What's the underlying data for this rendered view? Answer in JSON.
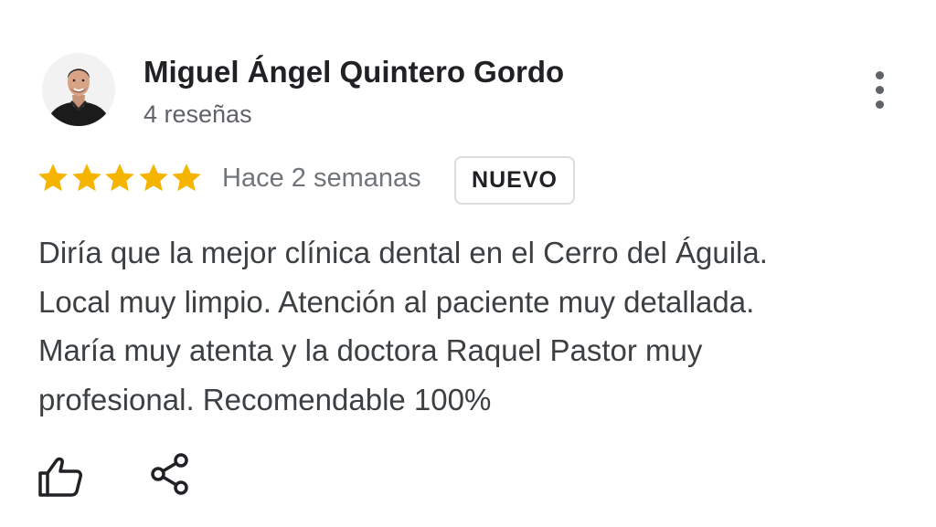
{
  "review": {
    "author": {
      "name": "Miguel Ángel Quintero Gordo",
      "review_count": "4 reseñas",
      "avatar_icon": "profile-photo"
    },
    "rating": {
      "stars": 5,
      "max": 5,
      "star_color": "#F4B400"
    },
    "time_ago": "Hace 2 semanas",
    "badge": "NUEVO",
    "text_lines": [
      "Diría que la mejor clínica dental en el Cerro del Águila.",
      "Local muy limpio. Atención al paciente muy detallada.",
      "María muy atenta y la doctora Raquel Pastor muy",
      "profesional. Recomendable 100%"
    ],
    "actions": {
      "like_icon": "thumb-up-icon",
      "share_icon": "share-icon",
      "more_icon": "more-vertical-icon"
    }
  }
}
